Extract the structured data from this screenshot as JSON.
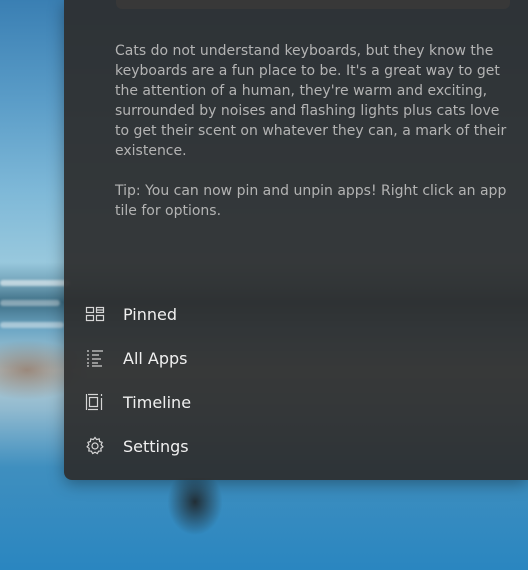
{
  "tips": {
    "paragraph_1": "Cats do not understand keyboards, but they know the keyboards are a fun place to be. It's a great way to get the attention of a human, they're warm and exciting, surrounded by noises and flashing lights plus cats love to get their scent on whatever they can, a mark of their existence.",
    "paragraph_2": "Tip: You can now pin and unpin apps! Right click an app tile for options."
  },
  "nav": {
    "items": [
      {
        "label": "Pinned",
        "icon": "pinned-icon"
      },
      {
        "label": "All Apps",
        "icon": "all-apps-icon"
      },
      {
        "label": "Timeline",
        "icon": "timeline-icon"
      },
      {
        "label": "Settings",
        "icon": "gear-icon"
      }
    ]
  },
  "colors": {
    "panel": "#2d2d2d",
    "text_primary": "#f0f0f0",
    "text_secondary": "#b3b3b3"
  }
}
